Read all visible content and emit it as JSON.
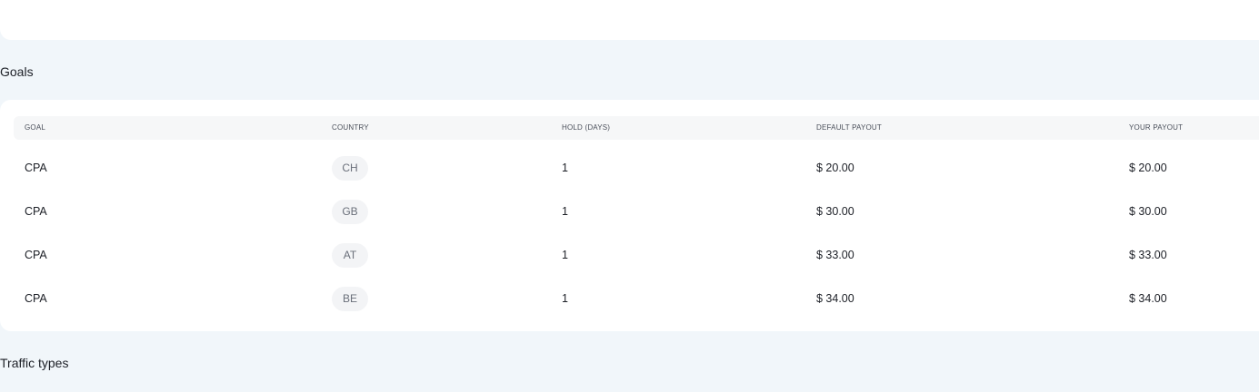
{
  "sections": {
    "goals_title": "Goals",
    "traffic_title": "Traffic types"
  },
  "goals_table": {
    "headers": {
      "goal": "GOAL",
      "country": "COUNTRY",
      "hold": "HOLD (DAYS)",
      "default_payout": "DEFAULT PAYOUT",
      "your_payout": "YOUR PAYOUT"
    },
    "rows": [
      {
        "goal": "CPA",
        "country": "CH",
        "hold": "1",
        "default_payout": "$ 20.00",
        "your_payout": "$ 20.00"
      },
      {
        "goal": "CPA",
        "country": "GB",
        "hold": "1",
        "default_payout": "$ 30.00",
        "your_payout": "$ 30.00"
      },
      {
        "goal": "CPA",
        "country": "AT",
        "hold": "1",
        "default_payout": "$ 33.00",
        "your_payout": "$ 33.00"
      },
      {
        "goal": "CPA",
        "country": "BE",
        "hold": "1",
        "default_payout": "$ 34.00",
        "your_payout": "$ 34.00"
      }
    ]
  },
  "colors": {
    "page_background": "#f1f6fa",
    "card_background": "#ffffff",
    "header_background": "#f6f7f8",
    "badge_background": "#f3f4f6"
  }
}
